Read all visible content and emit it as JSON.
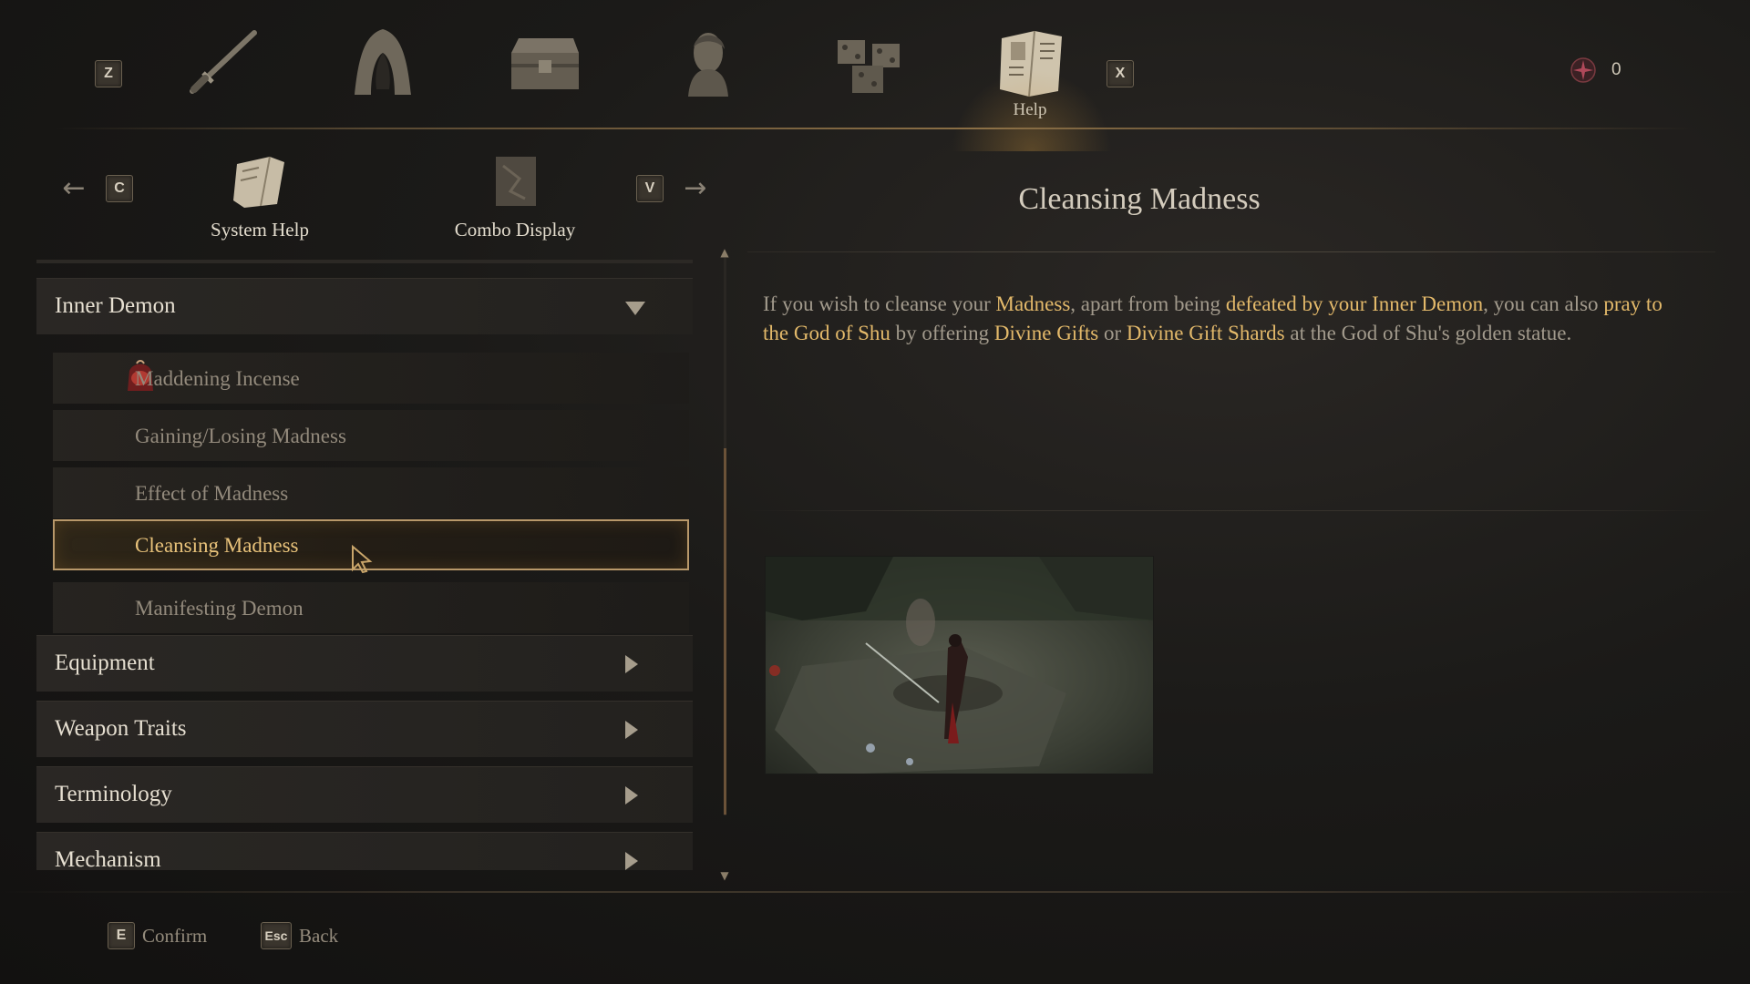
{
  "topnav": {
    "left_key": "Z",
    "right_key": "X",
    "tabs": [
      {
        "name": "weapon-tab",
        "icon": "sword-icon"
      },
      {
        "name": "armor-tab",
        "icon": "hood-icon"
      },
      {
        "name": "inventory-tab",
        "icon": "chest-icon"
      },
      {
        "name": "character-tab",
        "icon": "portrait-icon"
      },
      {
        "name": "items-tab",
        "icon": "boxes-icon"
      },
      {
        "name": "help-tab",
        "icon": "book-icon",
        "label": "Help",
        "active": true
      }
    ],
    "currency": {
      "icon": "spirit-gem-icon",
      "value": "0"
    }
  },
  "subnav": {
    "prev_key": "C",
    "next_key": "V",
    "tabs": [
      {
        "label": "System Help",
        "icon": "manual-icon",
        "active": true
      },
      {
        "label": "Combo Display",
        "icon": "scroll-icon",
        "active": false
      }
    ]
  },
  "list": {
    "categories": [
      {
        "label": "Inner Demon",
        "expanded": true
      },
      {
        "label": "Equipment",
        "expanded": false
      },
      {
        "label": "Weapon Traits",
        "expanded": false
      },
      {
        "label": "Terminology",
        "expanded": false
      },
      {
        "label": "Mechanism",
        "expanded": false
      }
    ],
    "inner_demon_items": [
      {
        "label": "Maddening Incense",
        "icon": "incense-icon"
      },
      {
        "label": "Gaining/Losing Madness"
      },
      {
        "label": "Effect of Madness"
      },
      {
        "label": "Cleansing Madness",
        "selected": true
      },
      {
        "label": "Manifesting Demon"
      }
    ]
  },
  "detail": {
    "title": "Cleansing Madness",
    "description": {
      "p1": "If you wish to cleanse your ",
      "h1": "Madness",
      "p2": ", apart from being ",
      "h2": "defeated by your Inner Demon",
      "p3": ", you can also ",
      "h3": "pray to the God of Shu",
      "p4": " by offering ",
      "h4": "Divine Gifts",
      "p5": " or ",
      "h5": "Divine Gift Shards",
      "p6": " at the God of Shu's golden statue."
    },
    "preview_icon": "gameplay-preview-image"
  },
  "footer": {
    "confirm_key": "E",
    "confirm_label": "Confirm",
    "back_key": "Esc",
    "back_label": "Back"
  },
  "colors": {
    "highlight": "#e3b96a",
    "selected_text": "#e8c27a",
    "selected_border": "#b8986a",
    "background": "#1b1a18"
  }
}
